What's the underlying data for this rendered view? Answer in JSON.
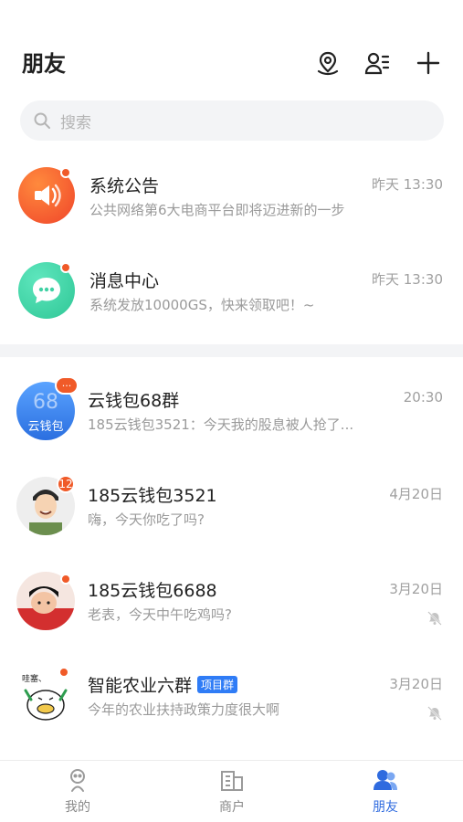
{
  "header": {
    "title": "朋友",
    "icons": [
      "location-icon",
      "contacts-icon",
      "add-icon"
    ]
  },
  "search": {
    "placeholder": "搜索"
  },
  "system_items": [
    {
      "name": "系统公告",
      "preview": "公共网络第6大电商平台即将迈进新的一步",
      "time": "昨天 13:30",
      "icon": "speaker-icon",
      "color": "#f05a28"
    },
    {
      "name": "消息中心",
      "preview": "系统发放10000GS，快来领取吧！~",
      "time": "昨天 13:30",
      "icon": "chat-bubble-icon",
      "color": "#3fd1a4"
    }
  ],
  "chats": [
    {
      "name": "云钱包68群",
      "preview": "185云钱包3521：今天我的股息被人抢了...",
      "time": "20:30",
      "avatar_text_top": "68",
      "avatar_text_bottom": "云钱包",
      "badge": "···"
    },
    {
      "name": "185云钱包3521",
      "preview": "嗨，今天你吃了吗?",
      "time": "4月20日",
      "badge": "12"
    },
    {
      "name": "185云钱包6688",
      "preview": "老表，今天中午吃鸡吗?",
      "time": "3月20日",
      "muted": true
    },
    {
      "name": "智能农业六群",
      "tag": "项目群",
      "preview": "今年的农业扶持政策力度很大啊",
      "time": "3月20日",
      "muted": true,
      "avatar_caption": "哇塞、"
    }
  ],
  "tabs": [
    {
      "label": "我的",
      "icon": "profile-icon",
      "active": false
    },
    {
      "label": "商户",
      "icon": "merchant-icon",
      "active": false
    },
    {
      "label": "朋友",
      "icon": "friends-icon",
      "active": true
    }
  ],
  "colors": {
    "accent": "#2f6bdf",
    "notice": "#f05a28",
    "message": "#3fd1a4",
    "tag": "#2f7cf6"
  }
}
